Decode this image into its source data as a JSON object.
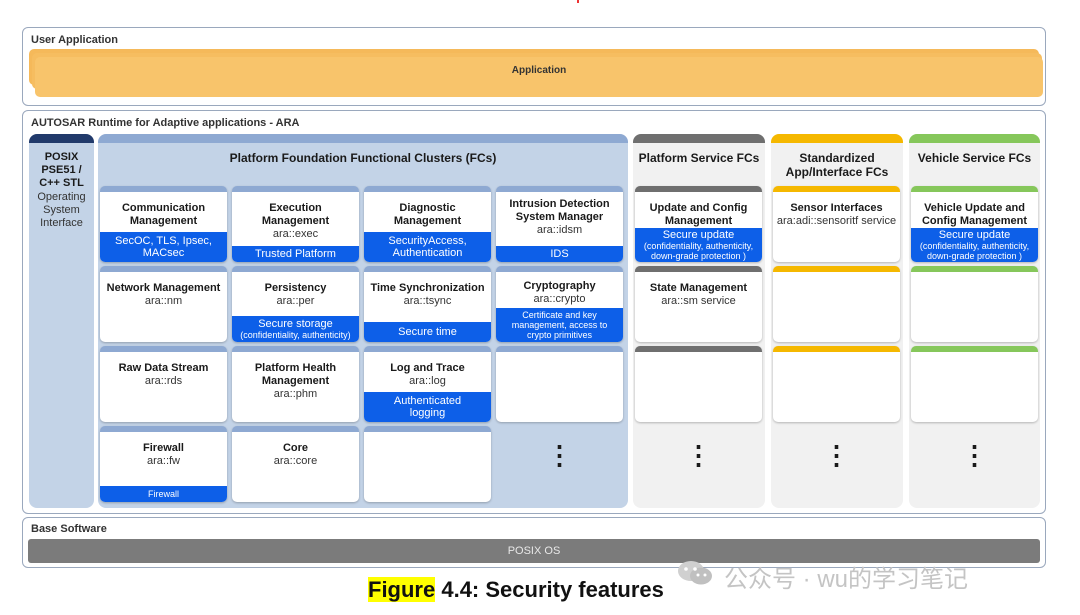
{
  "user_application": {
    "title": "User Application",
    "app_label": "Application"
  },
  "ara": {
    "title": "AUTOSAR Runtime for Adaptive applications - ARA"
  },
  "posix": {
    "lines": [
      "POSIX",
      "PSE51 /",
      "C++ STL"
    ],
    "sub": [
      "Operating",
      "System",
      "Interface"
    ]
  },
  "columns": {
    "platform_foundation": "Platform Foundation Functional Clusters (FCs)",
    "platform_service": "Platform Service FCs",
    "standardized": [
      "Standardized",
      "App/Interface FCs"
    ],
    "vehicle_service": "Vehicle Service FCs"
  },
  "foundation_boxes": [
    {
      "name": "Communication Management",
      "ns": "",
      "sec": "SecOC, TLS, Ipsec, MACsec"
    },
    {
      "name": "Execution Management",
      "ns": "ara::exec",
      "sec": "Trusted Platform"
    },
    {
      "name": "Diagnostic Management",
      "ns": "",
      "sec": "SecurityAccess, Authentication"
    },
    {
      "name": "Intrusion Detection System Manager",
      "ns": "ara::idsm",
      "sec": "IDS"
    },
    {
      "name": "Network Management",
      "ns": "ara::nm",
      "sec": ""
    },
    {
      "name": "Persistency",
      "ns": "ara::per",
      "sec": "Secure storage",
      "sec_small": "(confidentiality, authenticity)"
    },
    {
      "name": "Time Synchronization",
      "ns": "ara::tsync",
      "sec": "Secure time"
    },
    {
      "name": "Cryptography",
      "ns": "ara::crypto",
      "sec_small": "Certificate and key management, access to crypto primitives"
    },
    {
      "name": "Raw Data Stream",
      "ns": "ara::rds",
      "sec": ""
    },
    {
      "name": "Platform Health Management",
      "ns": "ara::phm",
      "sec": ""
    },
    {
      "name": "Log and Trace",
      "ns": "ara::log",
      "sec": "Authenticated logging"
    },
    {
      "name": "",
      "ns": "",
      "sec": ""
    },
    {
      "name": "Firewall",
      "ns": "ara::fw",
      "sec_small": "Firewall"
    },
    {
      "name": "Core",
      "ns": "ara::core",
      "sec": ""
    },
    {
      "name": "",
      "ns": "",
      "sec": ""
    }
  ],
  "service_boxes": [
    {
      "name": "Update and Config Management",
      "sec": "Secure update",
      "sec_small": "(confidentiality, authenticity, down-grade protection )"
    },
    {
      "name": "State Management",
      "ns": "ara::sm service"
    }
  ],
  "standardized_boxes": [
    {
      "name": "Sensor Interfaces",
      "ns": "ara:adi::sensoritf service"
    }
  ],
  "vehicle_boxes": [
    {
      "name": "Vehicle Update and Config Management",
      "sec": "Secure update",
      "sec_small": "(confidentiality, authenticity, down-grade protection )"
    }
  ],
  "dots": "⋮",
  "base_software": {
    "title": "Base Software",
    "os_label": "POSIX OS"
  },
  "caption": {
    "highlight": "Figure",
    "rest": " 4.4: Security features"
  },
  "watermark": "公众号 · wu的学习笔记",
  "colors": {
    "foundation_bg": "#c3d3e7",
    "posix_bg": "#c3d3e7",
    "posix_top": "#213a6b",
    "foundation_top": "#8ea9d2",
    "service_top": "#6f6f6f",
    "standardized_top": "#f5b800",
    "vehicle_top": "#86c75b",
    "security_blue": "#0d5fe8",
    "application_orange": "#f8c46b"
  }
}
